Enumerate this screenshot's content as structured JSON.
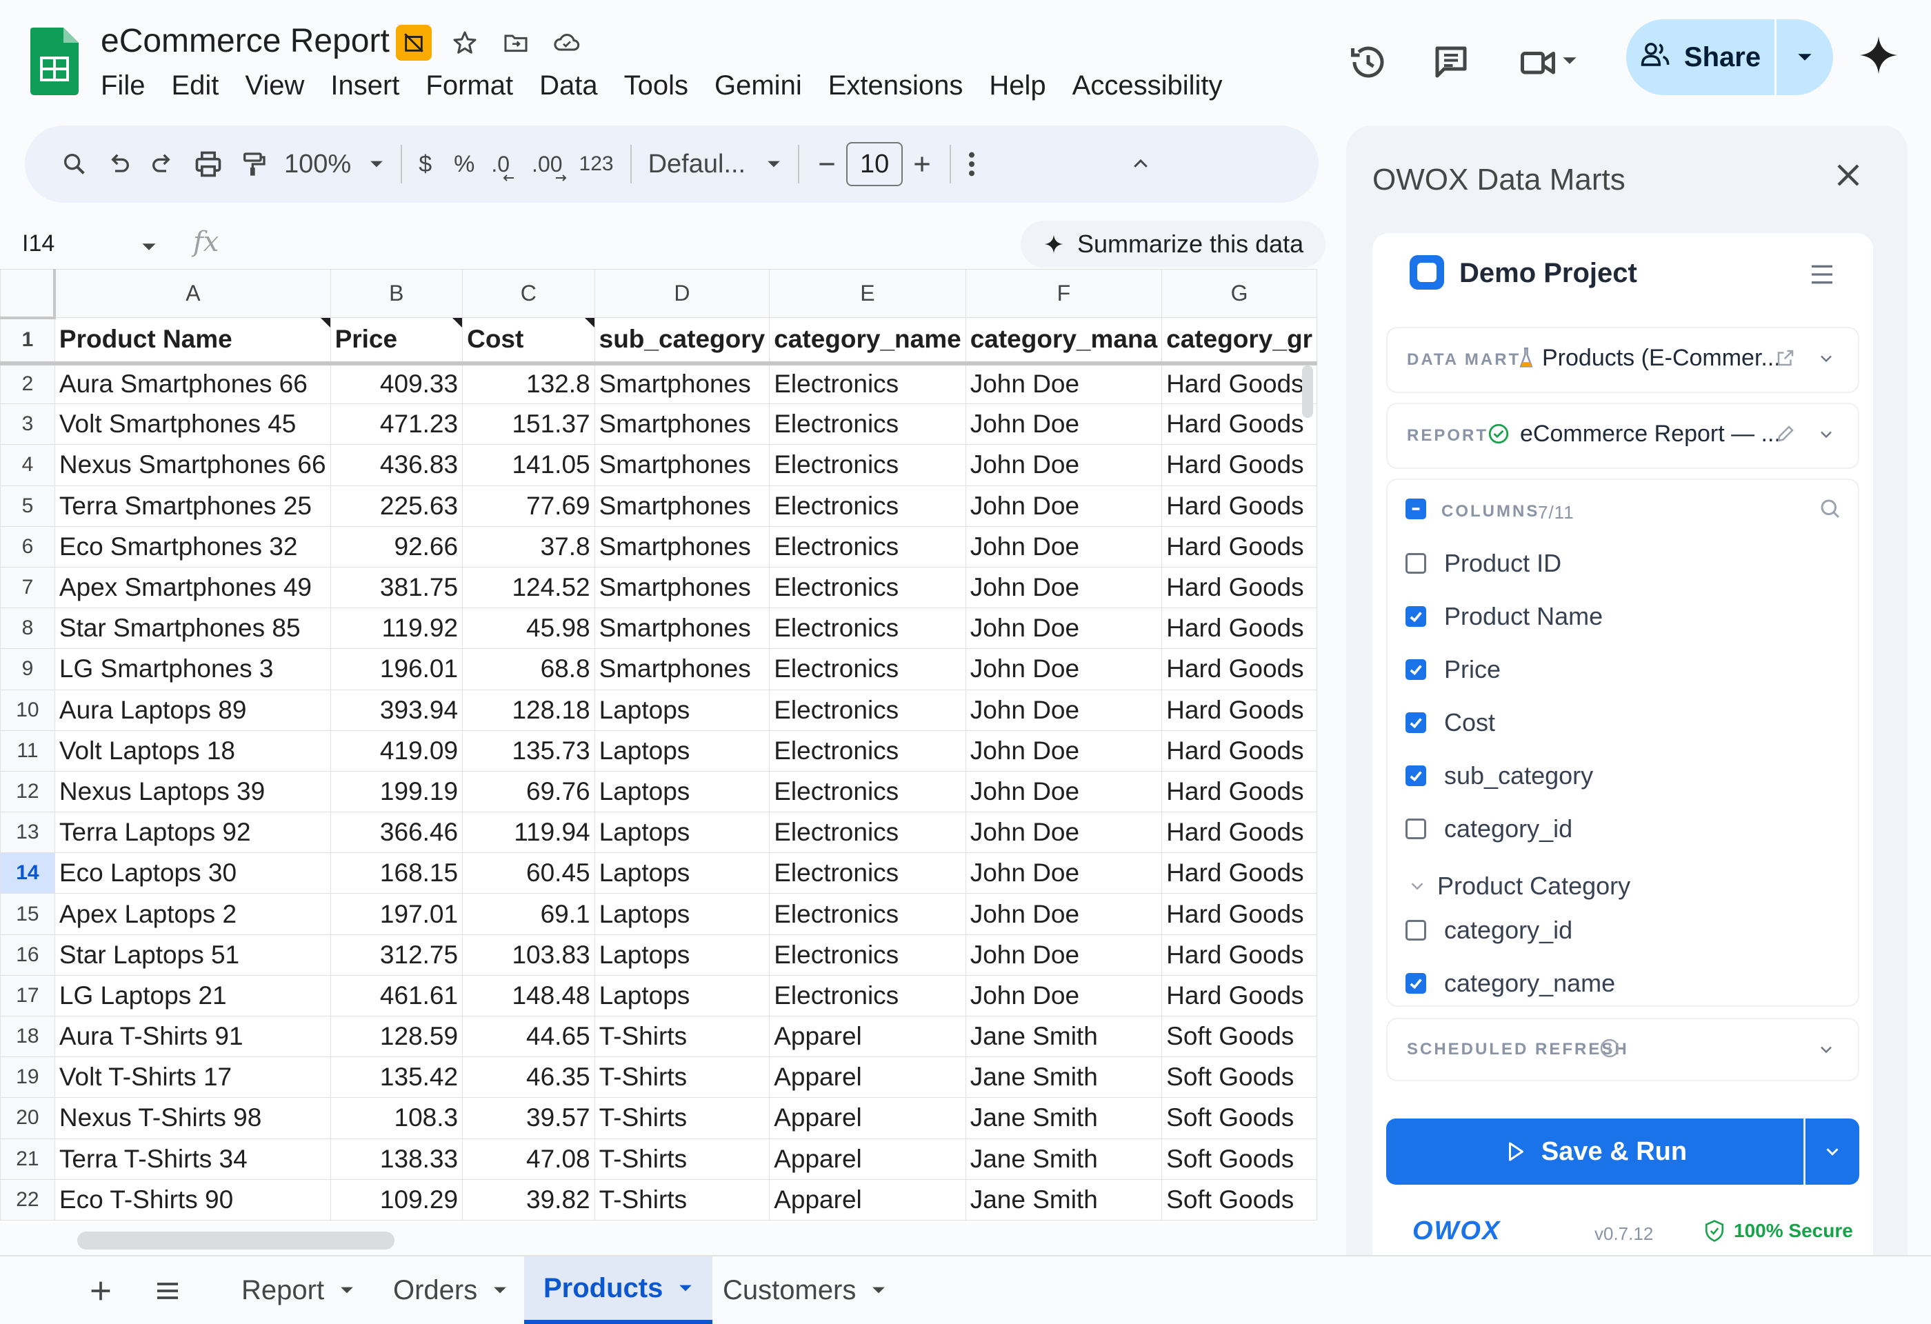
{
  "app": {
    "title": "eCommerce Report",
    "menu": [
      "File",
      "Edit",
      "View",
      "Insert",
      "Format",
      "Data",
      "Tools",
      "Gemini",
      "Extensions",
      "Help",
      "Accessibility"
    ],
    "share_label": "Share"
  },
  "toolbar": {
    "zoom": "100%",
    "currency": "$",
    "percent": "%",
    "dec_decrease": ".0",
    "dec_increase": ".00",
    "number_format": "123",
    "font": "Defaul...",
    "font_size": "10"
  },
  "formula_bar": {
    "cell_ref": "I14",
    "fx": "fx",
    "summarize_label": "Summarize this data"
  },
  "sheet": {
    "columns": [
      "A",
      "B",
      "C",
      "D",
      "E",
      "F",
      "G"
    ],
    "header_row": [
      "Product Name",
      "Price",
      "Cost",
      "sub_category",
      "category_name",
      "category_mana",
      "category_gr"
    ],
    "selected_row": 14,
    "rows": [
      {
        "n": 2,
        "cells": [
          "Aura Smartphones 66",
          "409.33",
          "132.8",
          "Smartphones",
          "Electronics",
          "John Doe",
          "Hard Goods"
        ]
      },
      {
        "n": 3,
        "cells": [
          "Volt Smartphones 45",
          "471.23",
          "151.37",
          "Smartphones",
          "Electronics",
          "John Doe",
          "Hard Goods"
        ]
      },
      {
        "n": 4,
        "cells": [
          "Nexus Smartphones 66",
          "436.83",
          "141.05",
          "Smartphones",
          "Electronics",
          "John Doe",
          "Hard Goods"
        ]
      },
      {
        "n": 5,
        "cells": [
          "Terra Smartphones 25",
          "225.63",
          "77.69",
          "Smartphones",
          "Electronics",
          "John Doe",
          "Hard Goods"
        ]
      },
      {
        "n": 6,
        "cells": [
          "Eco Smartphones 32",
          "92.66",
          "37.8",
          "Smartphones",
          "Electronics",
          "John Doe",
          "Hard Goods"
        ]
      },
      {
        "n": 7,
        "cells": [
          "Apex Smartphones 49",
          "381.75",
          "124.52",
          "Smartphones",
          "Electronics",
          "John Doe",
          "Hard Goods"
        ]
      },
      {
        "n": 8,
        "cells": [
          "Star Smartphones 85",
          "119.92",
          "45.98",
          "Smartphones",
          "Electronics",
          "John Doe",
          "Hard Goods"
        ]
      },
      {
        "n": 9,
        "cells": [
          "LG Smartphones 3",
          "196.01",
          "68.8",
          "Smartphones",
          "Electronics",
          "John Doe",
          "Hard Goods"
        ]
      },
      {
        "n": 10,
        "cells": [
          "Aura Laptops 89",
          "393.94",
          "128.18",
          "Laptops",
          "Electronics",
          "John Doe",
          "Hard Goods"
        ]
      },
      {
        "n": 11,
        "cells": [
          "Volt Laptops 18",
          "419.09",
          "135.73",
          "Laptops",
          "Electronics",
          "John Doe",
          "Hard Goods"
        ]
      },
      {
        "n": 12,
        "cells": [
          "Nexus Laptops 39",
          "199.19",
          "69.76",
          "Laptops",
          "Electronics",
          "John Doe",
          "Hard Goods"
        ]
      },
      {
        "n": 13,
        "cells": [
          "Terra Laptops 92",
          "366.46",
          "119.94",
          "Laptops",
          "Electronics",
          "John Doe",
          "Hard Goods"
        ]
      },
      {
        "n": 14,
        "cells": [
          "Eco Laptops 30",
          "168.15",
          "60.45",
          "Laptops",
          "Electronics",
          "John Doe",
          "Hard Goods"
        ]
      },
      {
        "n": 15,
        "cells": [
          "Apex Laptops 2",
          "197.01",
          "69.1",
          "Laptops",
          "Electronics",
          "John Doe",
          "Hard Goods"
        ]
      },
      {
        "n": 16,
        "cells": [
          "Star Laptops 51",
          "312.75",
          "103.83",
          "Laptops",
          "Electronics",
          "John Doe",
          "Hard Goods"
        ]
      },
      {
        "n": 17,
        "cells": [
          "LG Laptops 21",
          "461.61",
          "148.48",
          "Laptops",
          "Electronics",
          "John Doe",
          "Hard Goods"
        ]
      },
      {
        "n": 18,
        "cells": [
          "Aura T-Shirts 91",
          "128.59",
          "44.65",
          "T-Shirts",
          "Apparel",
          "Jane Smith",
          "Soft Goods"
        ]
      },
      {
        "n": 19,
        "cells": [
          "Volt T-Shirts 17",
          "135.42",
          "46.35",
          "T-Shirts",
          "Apparel",
          "Jane Smith",
          "Soft Goods"
        ]
      },
      {
        "n": 20,
        "cells": [
          "Nexus T-Shirts 98",
          "108.3",
          "39.57",
          "T-Shirts",
          "Apparel",
          "Jane Smith",
          "Soft Goods"
        ]
      },
      {
        "n": 21,
        "cells": [
          "Terra T-Shirts 34",
          "138.33",
          "47.08",
          "T-Shirts",
          "Apparel",
          "Jane Smith",
          "Soft Goods"
        ]
      },
      {
        "n": 22,
        "cells": [
          "Eco T-Shirts 90",
          "109.29",
          "39.82",
          "T-Shirts",
          "Apparel",
          "Jane Smith",
          "Soft Goods"
        ]
      }
    ]
  },
  "tabs": [
    {
      "label": "Report",
      "active": false
    },
    {
      "label": "Orders",
      "active": false
    },
    {
      "label": "Products",
      "active": true
    },
    {
      "label": "Customers",
      "active": false
    }
  ],
  "panel": {
    "title": "OWOX Data Marts",
    "project": "Demo Project",
    "data_mart_label": "DATA MART",
    "data_mart_value": "Products (E-Commer...",
    "report_label": "REPORT",
    "report_value": "eCommerce Report — ...",
    "columns_label": "COLUMNS",
    "columns_count": "7/11",
    "columns": [
      {
        "label": "Product ID",
        "checked": false
      },
      {
        "label": "Product Name",
        "checked": true
      },
      {
        "label": "Price",
        "checked": true
      },
      {
        "label": "Cost",
        "checked": true
      },
      {
        "label": "sub_category",
        "checked": true
      },
      {
        "label": "category_id",
        "checked": false
      }
    ],
    "group_label": "Product Category",
    "group_columns": [
      {
        "label": "category_id",
        "checked": false
      },
      {
        "label": "category_name",
        "checked": true
      }
    ],
    "scheduled_label": "SCHEDULED REFRESH",
    "save_run_label": "Save & Run",
    "brand": "OWOX",
    "version": "v0.7.12",
    "secure_label": "100% Secure"
  },
  "colors": {
    "accent": "#1a73e8",
    "sheets_green": "#0f9d58",
    "share_bg": "#c2e7ff",
    "active_tab": "#0b57d0",
    "secure_green": "#16a34a"
  }
}
